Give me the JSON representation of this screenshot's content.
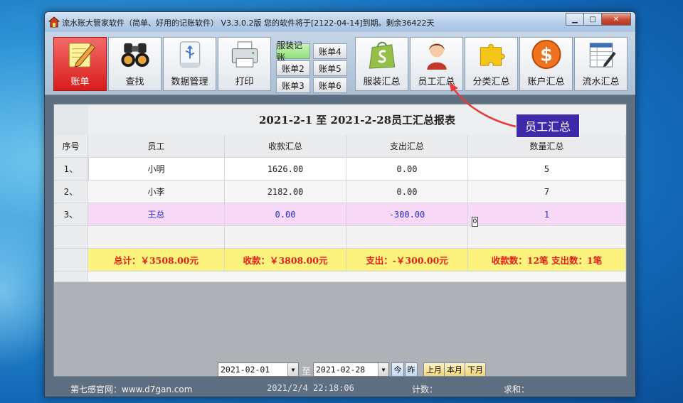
{
  "window": {
    "title": "流水账大管家软件（简单、好用的记账软件） V3.3.0.2版 您的软件将于[2122-04-14]到期。剩余36422天"
  },
  "toolbar": {
    "main_buttons": [
      {
        "label": "账单",
        "icon": "notepad-pencil-icon",
        "active": true
      },
      {
        "label": "查找",
        "icon": "binoculars-icon"
      },
      {
        "label": "数据管理",
        "icon": "usb-drive-icon"
      },
      {
        "label": "打印",
        "icon": "printer-icon"
      }
    ],
    "account_buttons": [
      {
        "label": "服装记账",
        "highlight": true
      },
      {
        "label": "账单4"
      },
      {
        "label": "账单2"
      },
      {
        "label": "账单5"
      },
      {
        "label": "账单3"
      },
      {
        "label": "账单6"
      }
    ],
    "summary_buttons": [
      {
        "label": "服装汇总",
        "icon": "shopify-bag-icon"
      },
      {
        "label": "员工汇总",
        "icon": "employee-avatar-icon"
      },
      {
        "label": "分类汇总",
        "icon": "puzzle-piece-icon"
      },
      {
        "label": "账户汇总",
        "icon": "dollar-coin-icon"
      },
      {
        "label": "流水汇总",
        "icon": "ledger-sheet-icon"
      }
    ]
  },
  "report": {
    "title": "2021-2-1  至  2021-2-28员工汇总报表",
    "columns": [
      "序号",
      "员工",
      "收款汇总",
      "支出汇总",
      "数量汇总"
    ],
    "rows": [
      {
        "idx": "1、",
        "name": "小明",
        "income": "1626.00",
        "expense": "0.00",
        "qty": "5"
      },
      {
        "idx": "2、",
        "name": "小李",
        "income": "2182.00",
        "expense": "0.00",
        "qty": "7"
      },
      {
        "idx": "3、",
        "name": "王总",
        "income": "0.00",
        "expense": "-300.00",
        "qty": "1"
      }
    ],
    "totals": {
      "total": "总计：￥3508.00元",
      "income": "收款：￥3808.00元",
      "expense": "支出：-￥300.00元",
      "counts": "收款数：12笔   支出数：1笔"
    }
  },
  "callout": {
    "text": "员工汇总"
  },
  "cursor_box": "0",
  "date_range": {
    "from": "2021-02-01",
    "separator": "至",
    "to": "2021-02-28",
    "today": "今",
    "yesterday": "昨",
    "last_month": "上月",
    "this_month": "本月",
    "next_month": "下月"
  },
  "status": {
    "website": "第七感官网：www.d7gan.com",
    "datetime": "2021/2/4 22:18:06",
    "count_label": "计数：",
    "sum_label": "求和："
  },
  "colors": {
    "active_button": "#d91c1c",
    "totals_bg": "#fbf37e",
    "totals_text": "#e0201c",
    "highlight_row": "#f7d9f7",
    "callout_bg": "#3e2aa8",
    "arrow": "#e8393c"
  }
}
